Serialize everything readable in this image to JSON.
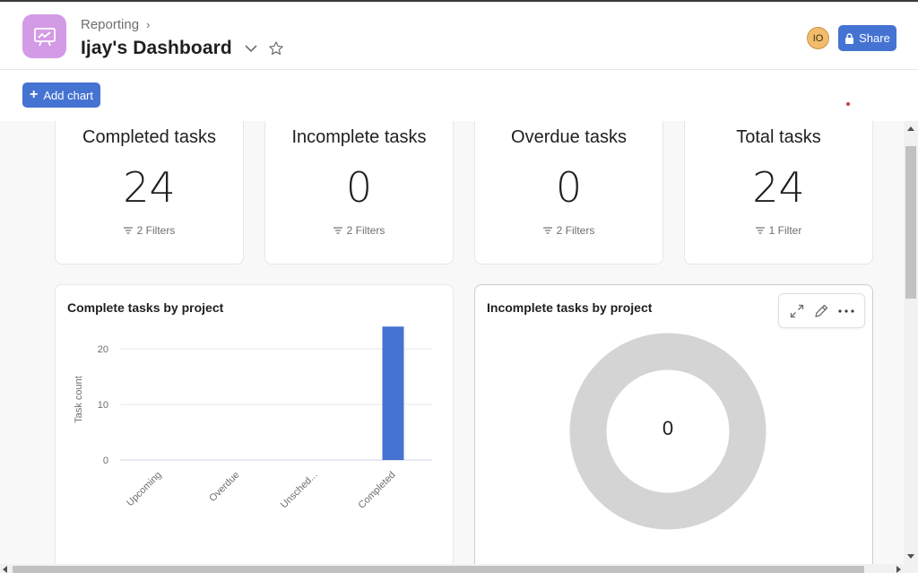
{
  "header": {
    "breadcrumb": "Reporting",
    "title": "Ijay's Dashboard",
    "app_icon": "presentation-icon",
    "avatar_initials": "IO",
    "share_label": "Share"
  },
  "toolbar": {
    "add_chart_label": "Add chart"
  },
  "stats": [
    {
      "label": "Completed tasks",
      "value": "24",
      "filters": "2 Filters"
    },
    {
      "label": "Incomplete tasks",
      "value": "0",
      "filters": "2 Filters"
    },
    {
      "label": "Overdue tasks",
      "value": "0",
      "filters": "2 Filters"
    },
    {
      "label": "Total tasks",
      "value": "24",
      "filters": "1 Filter"
    }
  ],
  "charts": {
    "complete": {
      "title": "Complete tasks by project"
    },
    "incomplete": {
      "title": "Incomplete tasks by project",
      "center_value": "0"
    }
  },
  "colors": {
    "accent": "#4573d2",
    "app_icon_bg": "#d39be6",
    "donut": "#d4d4d4"
  },
  "chart_data": [
    {
      "type": "bar",
      "title": "Complete tasks by project",
      "categories": [
        "Upcoming",
        "Overdue",
        "Unsched...",
        "Completed"
      ],
      "values": [
        0,
        0,
        0,
        24
      ],
      "xlabel": "",
      "ylabel": "Task count",
      "ylim": [
        0,
        25
      ],
      "yticks": [
        0,
        10,
        20
      ],
      "grid": true,
      "color": "#4573d2"
    },
    {
      "type": "pie",
      "title": "Incomplete tasks by project",
      "labels": [],
      "values": [],
      "center_label": "0",
      "color": "#d4d4d4"
    }
  ]
}
